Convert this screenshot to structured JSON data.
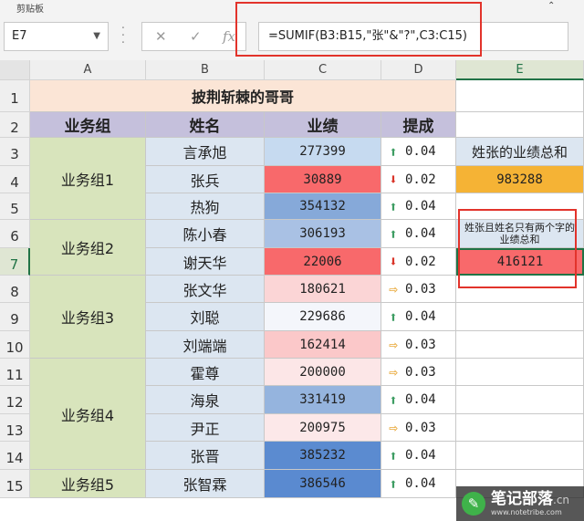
{
  "ribbon": {
    "tab_label": "剪贴板",
    "right_mark": "⌃"
  },
  "formula_bar": {
    "name_box": "E7",
    "formula": "=SUMIF(B3:B15,\"张\"&\"?\",C3:C15)",
    "fx_label": "fx",
    "cancel_symbol": "✕",
    "enter_symbol": "✓"
  },
  "columns": [
    "A",
    "B",
    "C",
    "D",
    "E"
  ],
  "rows": [
    "1",
    "2",
    "3",
    "4",
    "5",
    "6",
    "7",
    "8",
    "9",
    "10",
    "11",
    "12",
    "13",
    "14",
    "15"
  ],
  "sheet": {
    "title": "披荆斩棘的哥哥",
    "headers": {
      "group": "业务组",
      "name": "姓名",
      "score": "业绩",
      "commission": "提成"
    },
    "groups": [
      "业务组1",
      "业务组2",
      "业务组3",
      "业务组4",
      "业务组5"
    ],
    "records": [
      {
        "name": "言承旭",
        "score": "277399",
        "arrow": "up",
        "commission": "0.04",
        "fill": "#c6daf0"
      },
      {
        "name": "张兵",
        "score": "30889",
        "arrow": "down",
        "commission": "0.02",
        "fill": "#f8696b"
      },
      {
        "name": "热狗",
        "score": "354132",
        "arrow": "up",
        "commission": "0.04",
        "fill": "#86a9d9"
      },
      {
        "name": "陈小春",
        "score": "306193",
        "arrow": "up",
        "commission": "0.04",
        "fill": "#a9c1e4"
      },
      {
        "name": "谢天华",
        "score": "22006",
        "arrow": "down",
        "commission": "0.02",
        "fill": "#f8696b"
      },
      {
        "name": "张文华",
        "score": "180621",
        "arrow": "right",
        "commission": "0.03",
        "fill": "#fbd5d6"
      },
      {
        "name": "刘聪",
        "score": "229686",
        "arrow": "up",
        "commission": "0.04",
        "fill": "#f4f6fb"
      },
      {
        "name": "刘端端",
        "score": "162414",
        "arrow": "right",
        "commission": "0.03",
        "fill": "#fbc8c9"
      },
      {
        "name": "霍尊",
        "score": "200000",
        "arrow": "right",
        "commission": "0.03",
        "fill": "#fce6e7"
      },
      {
        "name": "海泉",
        "score": "331419",
        "arrow": "up",
        "commission": "0.04",
        "fill": "#95b4de"
      },
      {
        "name": "尹正",
        "score": "200975",
        "arrow": "right",
        "commission": "0.03",
        "fill": "#fce8e9"
      },
      {
        "name": "张晋",
        "score": "385232",
        "arrow": "up",
        "commission": "0.04",
        "fill": "#5b8bd0"
      },
      {
        "name": "张智霖",
        "score": "386546",
        "arrow": "up",
        "commission": "0.04",
        "fill": "#5a8ad0"
      }
    ],
    "summary1_label": "姓张的业绩总和",
    "summary1_value": "983288",
    "summary2_label": "姓张且姓名只有两个字的业绩总和",
    "summary2_value": "416121"
  },
  "colors": {
    "arrow_up": "#3e9d63",
    "arrow_down": "#d9352a",
    "arrow_right": "#e8a838",
    "highlight_red": "#e2332b"
  },
  "watermark": {
    "text": "笔记部落",
    "sub": "www.notetribe.com",
    "suffix": ".cn"
  }
}
